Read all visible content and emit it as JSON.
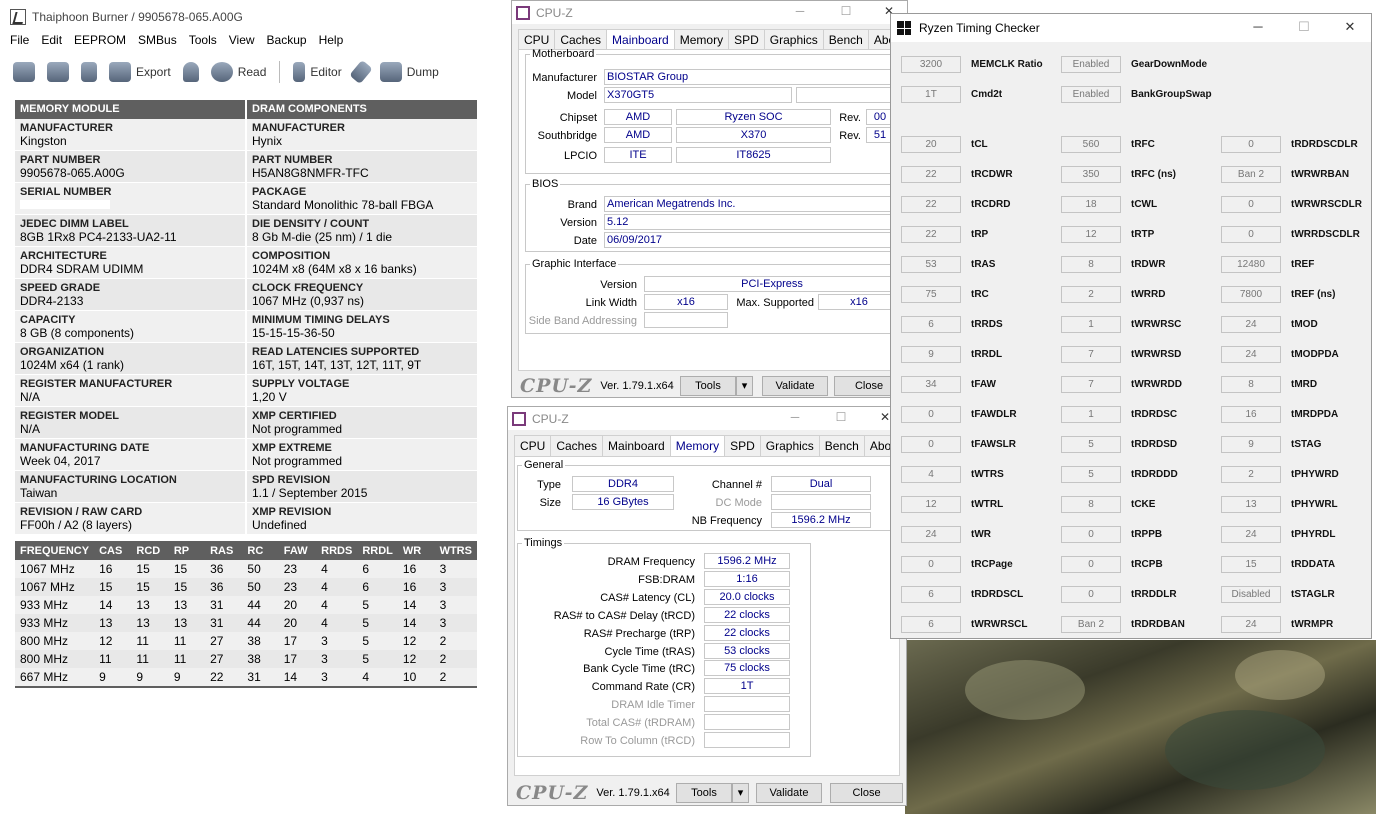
{
  "thaiphoon": {
    "title": "Thaiphoon Burner / 9905678-065.A00G",
    "menu": [
      "File",
      "Edit",
      "EEPROM",
      "SMBus",
      "Tools",
      "View",
      "Backup",
      "Help"
    ],
    "toolbar": {
      "export": "Export",
      "read": "Read",
      "editor": "Editor",
      "dump": "Dump"
    },
    "headers": {
      "left": "MEMORY MODULE",
      "right": "DRAM COMPONENTS"
    },
    "rows": [
      {
        "l_label": "MANUFACTURER",
        "l_value": "Kingston",
        "r_label": "MANUFACTURER",
        "r_value": "Hynix"
      },
      {
        "l_label": "PART NUMBER",
        "l_value": "9905678-065.A00G",
        "r_label": "PART NUMBER",
        "r_value": "H5AN8G8NMFR-TFC"
      },
      {
        "l_label": "SERIAL NUMBER",
        "l_value": "",
        "r_label": "PACKAGE",
        "r_value": "Standard Monolithic 78-ball FBGA"
      },
      {
        "l_label": "JEDEC DIMM LABEL",
        "l_value": "8GB 1Rx8 PC4-2133-UA2-11",
        "r_label": "DIE DENSITY / COUNT",
        "r_value": "8 Gb M-die (25 nm) / 1 die"
      },
      {
        "l_label": "ARCHITECTURE",
        "l_value": "DDR4 SDRAM UDIMM",
        "r_label": "COMPOSITION",
        "r_value": "1024M x8 (64M x8 x 16 banks)"
      },
      {
        "l_label": "SPEED GRADE",
        "l_value": "DDR4-2133",
        "r_label": "CLOCK FREQUENCY",
        "r_value": "1067 MHz (0,937 ns)"
      },
      {
        "l_label": "CAPACITY",
        "l_value": "8 GB (8 components)",
        "r_label": "MINIMUM TIMING DELAYS",
        "r_value": "15-15-15-36-50"
      },
      {
        "l_label": "ORGANIZATION",
        "l_value": "1024M x64 (1 rank)",
        "r_label": "READ LATENCIES SUPPORTED",
        "r_value": "16T, 15T, 14T, 13T, 12T, 11T, 9T"
      },
      {
        "l_label": "REGISTER MANUFACTURER",
        "l_value": "N/A",
        "r_label": "SUPPLY VOLTAGE",
        "r_value": "1,20 V"
      },
      {
        "l_label": "REGISTER MODEL",
        "l_value": "N/A",
        "r_label": "XMP CERTIFIED",
        "r_value": "Not programmed"
      },
      {
        "l_label": "MANUFACTURING DATE",
        "l_value": "Week 04, 2017",
        "r_label": "XMP EXTREME",
        "r_value": "Not programmed"
      },
      {
        "l_label": "MANUFACTURING LOCATION",
        "l_value": "Taiwan",
        "r_label": "SPD REVISION",
        "r_value": "1.1 / September 2015"
      },
      {
        "l_label": "REVISION / RAW CARD",
        "l_value": "FF00h / A2 (8 layers)",
        "r_label": "XMP REVISION",
        "r_value": "Undefined"
      }
    ],
    "freq_headers": [
      "FREQUENCY",
      "CAS",
      "RCD",
      "RP",
      "RAS",
      "RC",
      "FAW",
      "RRDS",
      "RRDL",
      "WR",
      "WTRS"
    ],
    "freq_rows": [
      [
        "1067 MHz",
        "16",
        "15",
        "15",
        "36",
        "50",
        "23",
        "4",
        "6",
        "16",
        "3"
      ],
      [
        "1067 MHz",
        "15",
        "15",
        "15",
        "36",
        "50",
        "23",
        "4",
        "6",
        "16",
        "3"
      ],
      [
        "933 MHz",
        "14",
        "13",
        "13",
        "31",
        "44",
        "20",
        "4",
        "5",
        "14",
        "3"
      ],
      [
        "933 MHz",
        "13",
        "13",
        "13",
        "31",
        "44",
        "20",
        "4",
        "5",
        "14",
        "3"
      ],
      [
        "800 MHz",
        "12",
        "11",
        "11",
        "27",
        "38",
        "17",
        "3",
        "5",
        "12",
        "2"
      ],
      [
        "800 MHz",
        "11",
        "11",
        "11",
        "27",
        "38",
        "17",
        "3",
        "5",
        "12",
        "2"
      ],
      [
        "667 MHz",
        "9",
        "9",
        "9",
        "22",
        "31",
        "14",
        "3",
        "4",
        "10",
        "2"
      ]
    ]
  },
  "cpuz_mainboard": {
    "title": "CPU-Z",
    "tabs": [
      "CPU",
      "Caches",
      "Mainboard",
      "Memory",
      "SPD",
      "Graphics",
      "Bench",
      "About"
    ],
    "active_tab": "Mainboard",
    "motherboard_legend": "Motherboard",
    "manufacturer_label": "Manufacturer",
    "manufacturer": "BIOSTAR Group",
    "model_label": "Model",
    "model": "X370GT5",
    "chipset_label": "Chipset",
    "chipset_vendor": "AMD",
    "chipset_name": "Ryzen SOC",
    "rev_label": "Rev.",
    "chipset_rev": "00",
    "southbridge_label": "Southbridge",
    "sb_vendor": "AMD",
    "sb_name": "X370",
    "sb_rev": "51",
    "lpcio_label": "LPCIO",
    "lpcio_vendor": "ITE",
    "lpcio_name": "IT8625",
    "bios_legend": "BIOS",
    "brand_label": "Brand",
    "brand": "American Megatrends Inc.",
    "version_label": "Version",
    "version": "5.12",
    "date_label": "Date",
    "date": "06/09/2017",
    "graphic_legend": "Graphic Interface",
    "gi_version_label": "Version",
    "gi_version": "PCI-Express",
    "link_width_label": "Link Width",
    "link_width": "x16",
    "max_supported_label": "Max. Supported",
    "max_supported": "x16",
    "side_band_label": "Side Band Addressing",
    "logo": "CPU-Z",
    "ver": "Ver. 1.79.1.x64",
    "tools": "Tools",
    "validate": "Validate",
    "close": "Close"
  },
  "cpuz_memory": {
    "title": "CPU-Z",
    "tabs": [
      "CPU",
      "Caches",
      "Mainboard",
      "Memory",
      "SPD",
      "Graphics",
      "Bench",
      "About"
    ],
    "active_tab": "Memory",
    "general_legend": "General",
    "type_label": "Type",
    "type": "DDR4",
    "size_label": "Size",
    "size": "16 GBytes",
    "channel_label": "Channel #",
    "channel": "Dual",
    "dc_mode_label": "DC Mode",
    "nb_freq_label": "NB Frequency",
    "nb_freq": "1596.2 MHz",
    "timings_legend": "Timings",
    "timings": [
      {
        "label": "DRAM Frequency",
        "value": "1596.2 MHz",
        "dim": false
      },
      {
        "label": "FSB:DRAM",
        "value": "1:16",
        "dim": false
      },
      {
        "label": "CAS# Latency (CL)",
        "value": "20.0 clocks",
        "dim": false
      },
      {
        "label": "RAS# to CAS# Delay (tRCD)",
        "value": "22 clocks",
        "dim": false
      },
      {
        "label": "RAS# Precharge (tRP)",
        "value": "22 clocks",
        "dim": false
      },
      {
        "label": "Cycle Time (tRAS)",
        "value": "53 clocks",
        "dim": false
      },
      {
        "label": "Bank Cycle Time (tRC)",
        "value": "75 clocks",
        "dim": false
      },
      {
        "label": "Command Rate (CR)",
        "value": "1T",
        "dim": false
      },
      {
        "label": "DRAM Idle Timer",
        "value": "",
        "dim": true
      },
      {
        "label": "Total CAS# (tRDRAM)",
        "value": "",
        "dim": true
      },
      {
        "label": "Row To Column (tRCD)",
        "value": "",
        "dim": true
      }
    ],
    "logo": "CPU-Z",
    "ver": "Ver. 1.79.1.x64",
    "tools": "Tools",
    "validate": "Validate",
    "close": "Close"
  },
  "rtc": {
    "title": "Ryzen Timing Checker",
    "top": [
      {
        "v1": "3200",
        "n1": "MEMCLK Ratio",
        "v2": "Enabled",
        "n2": "GearDownMode"
      },
      {
        "v1": "1T",
        "n1": "Cmd2t",
        "v2": "Enabled",
        "n2": "BankGroupSwap"
      }
    ],
    "rows": [
      [
        "20",
        "tCL",
        "560",
        "tRFC",
        "0",
        "tRDRDSCDLR"
      ],
      [
        "22",
        "tRCDWR",
        "350",
        "tRFC (ns)",
        "Ban 2",
        "tWRWRBAN"
      ],
      [
        "22",
        "tRCDRD",
        "18",
        "tCWL",
        "0",
        "tWRWRSCDLR"
      ],
      [
        "22",
        "tRP",
        "12",
        "tRTP",
        "0",
        "tWRRDSCDLR"
      ],
      [
        "53",
        "tRAS",
        "8",
        "tRDWR",
        "12480",
        "tREF"
      ],
      [
        "75",
        "tRC",
        "2",
        "tWRRD",
        "7800",
        "tREF (ns)"
      ],
      [
        "6",
        "tRRDS",
        "1",
        "tWRWRSC",
        "24",
        "tMOD"
      ],
      [
        "9",
        "tRRDL",
        "7",
        "tWRWRSD",
        "24",
        "tMODPDA"
      ],
      [
        "34",
        "tFAW",
        "7",
        "tWRWRDD",
        "8",
        "tMRD"
      ],
      [
        "0",
        "tFAWDLR",
        "1",
        "tRDRDSC",
        "16",
        "tMRDPDA"
      ],
      [
        "0",
        "tFAWSLR",
        "5",
        "tRDRDSD",
        "9",
        "tSTAG"
      ],
      [
        "4",
        "tWTRS",
        "5",
        "tRDRDDD",
        "2",
        "tPHYWRD"
      ],
      [
        "12",
        "tWTRL",
        "8",
        "tCKE",
        "13",
        "tPHYWRL"
      ],
      [
        "24",
        "tWR",
        "0",
        "tRPPB",
        "24",
        "tPHYRDL"
      ],
      [
        "0",
        "tRCPage",
        "0",
        "tRCPB",
        "15",
        "tRDDATA"
      ],
      [
        "6",
        "tRDRDSCL",
        "0",
        "tRRDDLR",
        "Disabled",
        "tSTAGLR"
      ],
      [
        "6",
        "tWRWRSCL",
        "Ban 2",
        "tRDRDBAN",
        "24",
        "tWRMPR"
      ]
    ]
  }
}
